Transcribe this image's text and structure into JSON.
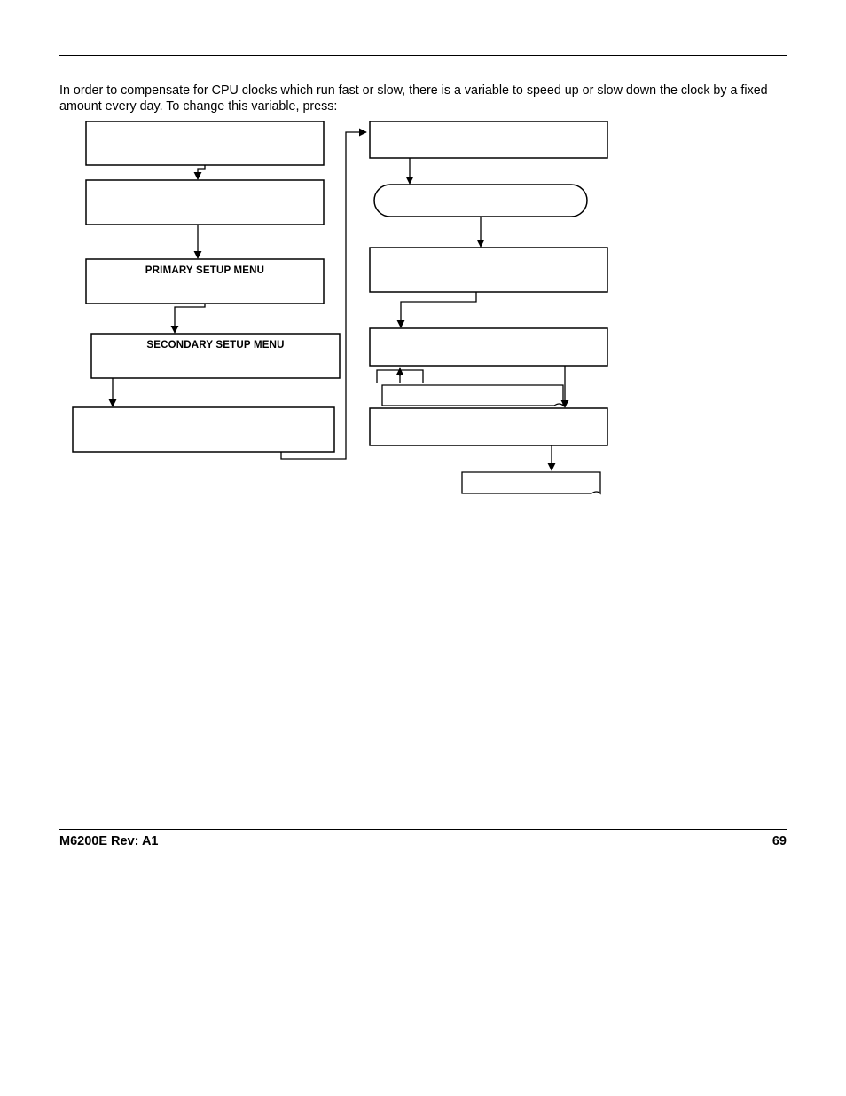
{
  "intro": "In order to compensate for CPU clocks which run fast or slow, there is a variable to speed up or slow down the clock by a fixed amount every day. To change this variable, press:",
  "flow": {
    "left": {
      "box1": "",
      "box2": "",
      "box3": "PRIMARY SETUP MENU",
      "box4": "SECONDARY SETUP MENU",
      "box5": ""
    },
    "right": {
      "box1": "",
      "oval": "",
      "box2": "",
      "box3": "",
      "note1": "",
      "box4": "",
      "note2": ""
    }
  },
  "footer": {
    "rev": "M6200E Rev: A1",
    "page": "69"
  }
}
